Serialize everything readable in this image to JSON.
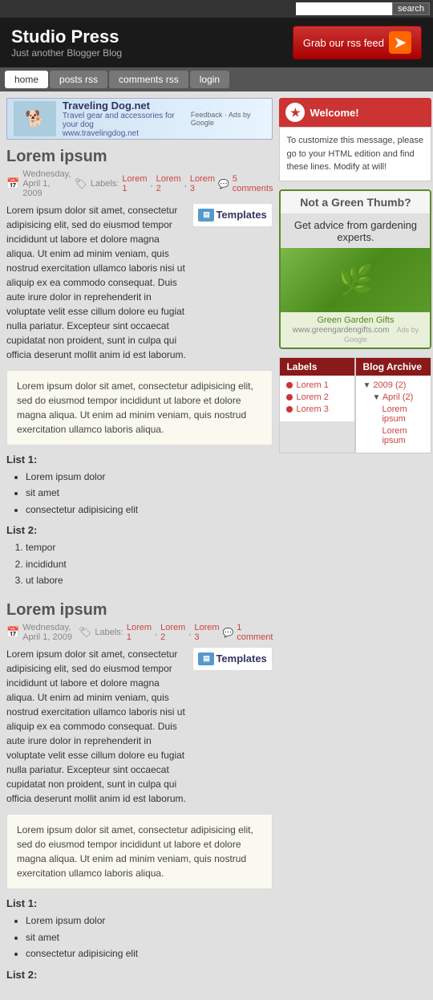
{
  "topbar": {
    "search_placeholder": "",
    "search_label": "Search",
    "search_button": "search"
  },
  "header": {
    "title": "Studio Press",
    "tagline": "Just another Blogger Blog",
    "rss_label": "Grab our rss feed"
  },
  "nav": {
    "items": [
      {
        "label": "home",
        "active": true
      },
      {
        "label": "posts rss",
        "active": false
      },
      {
        "label": "comments rss",
        "active": false
      },
      {
        "label": "login",
        "active": false
      }
    ]
  },
  "banner": {
    "title": "Traveling Dog.net",
    "subtitle": "Travel gear and accessories for your dog",
    "link": "www.travelingdog.net",
    "feedback": "Feedback · Ads by Google"
  },
  "posts": [
    {
      "id": "post1",
      "title": "Lorem ipsum",
      "date": "Wednesday, April 1, 2009",
      "labels_prefix": "Labels:",
      "labels": [
        "Lorem 1",
        "Lorem 2",
        "Lorem 3"
      ],
      "comments": "5 comments",
      "body": "Lorem ipsum dolor sit amet, consectetur adipisicing elit, sed do eiusmod tempor incididunt ut labore et dolore magna aliqua. Ut enim ad minim veniam, quis nostrud exercitation ullamco laboris nisi ut aliquip ex ea commodo consequat. Duis aute irure dolor in reprehenderit in voluptate velit esse cillum dolore eu fugiat nulla pariatur. Excepteur sint occaecat cupidatat non proident, sunt in culpa qui officia deserunt mollit anim id est laborum.",
      "templates_label": "Templates",
      "quote": "Lorem ipsum dolor sit amet, consectetur adipisicing elit, sed do eiusmod tempor incididunt ut labore et dolore magna aliqua. Ut enim ad minim veniam, quis nostrud exercitation ullamco laboris aliqua.",
      "list1_label": "List 1:",
      "list1": [
        "Lorem ipsum dolor",
        "sit amet",
        "consectetur adipisicing elit"
      ],
      "list2_label": "List 2:",
      "list2": [
        "tempor",
        "incididunt",
        "ut labore"
      ]
    },
    {
      "id": "post2",
      "title": "Lorem ipsum",
      "date": "Wednesday, April 1, 2009",
      "labels_prefix": "Labels:",
      "labels": [
        "Lorem 1",
        "Lorem 2",
        "Lorem 3"
      ],
      "comments": "1 comment",
      "body": "Lorem ipsum dolor sit amet, consectetur adipisicing elit, sed do eiusmod tempor incididunt ut labore et dolore magna aliqua. Ut enim ad minim veniam, quis nostrud exercitation ullamco laboris nisi ut aliquip ex ea commodo consequat. Duis aute irure dolor in reprehenderit in voluptate velit esse cillum dolore eu fugiat nulla pariatur. Excepteur sint occaecat cupidatat non proident, sunt in culpa qui officia deserunt mollit anim id est laborum.",
      "templates_label": "Templates",
      "quote": "Lorem ipsum dolor sit amet, consectetur adipisicing elit, sed do eiusmod tempor incididunt ut labore et dolore magna aliqua. Ut enim ad minim veniam, quis nostrud exercitation ullamco laboris aliqua.",
      "list1_label": "List 1:",
      "list1": [
        "Lorem ipsum dolor",
        "sit amet",
        "consectetur adipisicing elit"
      ],
      "list2_label": "List 2:"
    }
  ],
  "sidebar": {
    "welcome_title": "Welcome!",
    "welcome_body": "To customize this message, please go to your HTML edition and find these lines. Modify at will!",
    "garden_title": "Not a Green Thumb?",
    "garden_subtitle": "Get advice from gardening experts.",
    "garden_brand": "Green Garden Gifts",
    "garden_link": "www.greengardengifts.com",
    "garden_ads": "Ads by Google",
    "labels_title": "Labels",
    "archive_title": "Blog Archive",
    "labels": [
      "Lorem 1",
      "Lorem 2",
      "Lorem 3"
    ],
    "archive": {
      "year": "2009 (2)",
      "month": "April (2)",
      "entries": [
        "Lorem ipsum",
        "Lorem ipsum"
      ]
    }
  },
  "colors": {
    "accent": "#c33333",
    "header_bg": "#1a1a1a",
    "nav_bg": "#555555"
  }
}
